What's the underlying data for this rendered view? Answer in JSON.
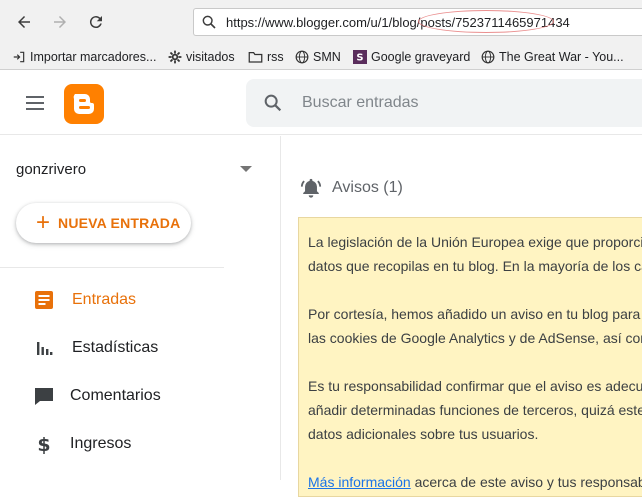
{
  "browser": {
    "url": "https://www.blogger.com/u/1/blog/posts/7523711465971434",
    "bookmarks": [
      {
        "label": "Importar marcadores...",
        "icon": "import-icon"
      },
      {
        "label": "visitados",
        "icon": "gear-icon"
      },
      {
        "label": "rss",
        "icon": "folder-icon"
      },
      {
        "label": "SMN",
        "icon": "globe-icon"
      },
      {
        "label": "Google graveyard",
        "icon": "s-logo-icon"
      },
      {
        "label": "The Great War - You...",
        "icon": "globe-icon"
      }
    ]
  },
  "header": {
    "search_placeholder": "Buscar entradas",
    "brand_color": "#ff8000"
  },
  "sidebar": {
    "blog_name": "gonzrivero",
    "new_post_label": "NUEVA ENTRADA",
    "items": [
      {
        "label": "Entradas",
        "icon": "posts-icon",
        "active": true
      },
      {
        "label": "Estadísticas",
        "icon": "stats-icon",
        "active": false
      },
      {
        "label": "Comentarios",
        "icon": "comments-icon",
        "active": false
      },
      {
        "label": "Ingresos",
        "icon": "dollar-icon",
        "active": false
      }
    ]
  },
  "main": {
    "notices_title": "Avisos",
    "notices_count": "(1)",
    "notice": {
      "p1_line1": "La legislación de la Unión Europea exige que proporcio",
      "p1_line2": "datos que recopilas en tu blog. En la mayoría de los ca",
      "p2_line1": "Por cortesía, hemos añadido un aviso en tu blog para e",
      "p2_line2": "las cookies de Google Analytics y de AdSense, así com",
      "p3_line1": "Es tu responsabilidad confirmar que el aviso es adecu",
      "p3_line2": "añadir determinadas funciones de terceros, quizá este",
      "p3_line3": "datos adicionales sobre tus usuarios.",
      "link_text": "Más información",
      "p4_rest": " acerca de este aviso y tus responsab"
    }
  },
  "colors": {
    "accent": "#e8710a",
    "notice_bg": "#fff4c2",
    "link": "#1a73e8"
  }
}
